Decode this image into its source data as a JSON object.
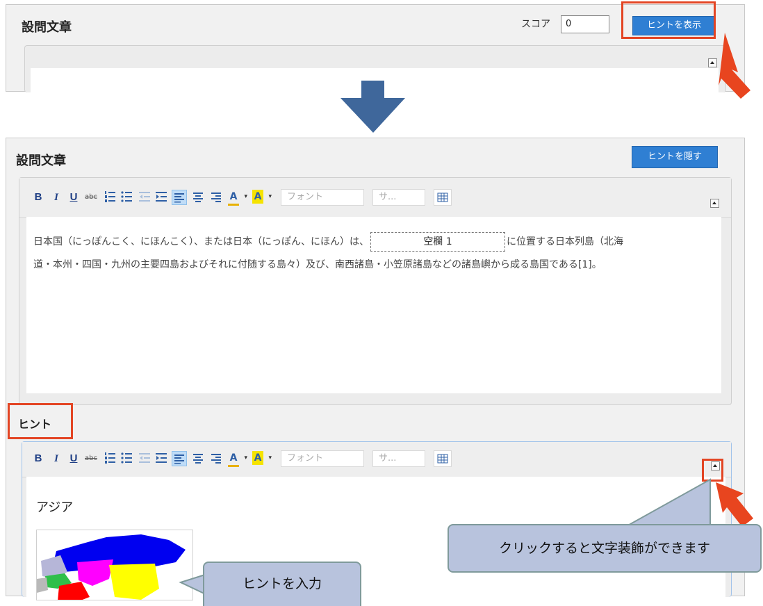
{
  "top_panel": {
    "title": "設問文章",
    "score_label": "スコア",
    "score_value": "0",
    "show_hint_button": "ヒントを表示"
  },
  "main_panel": {
    "title": "設問文章",
    "hide_hint_button": "ヒントを隠す",
    "toolbar": {
      "bold": "B",
      "italic": "I",
      "underline": "U",
      "strike": "abc",
      "font_placeholder": "フォント",
      "size_placeholder": "サ..."
    },
    "question_text_before": "日本国（にっぽんこく、にほんこく）、または日本（にっぽん、にほん）は、",
    "blank_label": "空欄 1",
    "question_text_after_line1": "に位置する日本列島（北海",
    "question_text_line2": "道・本州・四国・九州の主要四島およびそれに付随する島々）及び、南西諸島・小笠原諸島などの諸島嶼から成る島国である[1]。"
  },
  "hint_section": {
    "title": "ヒント",
    "content_heading": "アジア",
    "map_icon": "asia-map-image"
  },
  "callouts": {
    "decoration": "クリックすると文字装飾ができます",
    "input_hint": "ヒントを入力"
  },
  "colors": {
    "accent_blue": "#2f7fd3",
    "highlight_red": "#e34524",
    "arrow_blue": "#3f679b",
    "callout_fill": "#b8c3dd"
  }
}
